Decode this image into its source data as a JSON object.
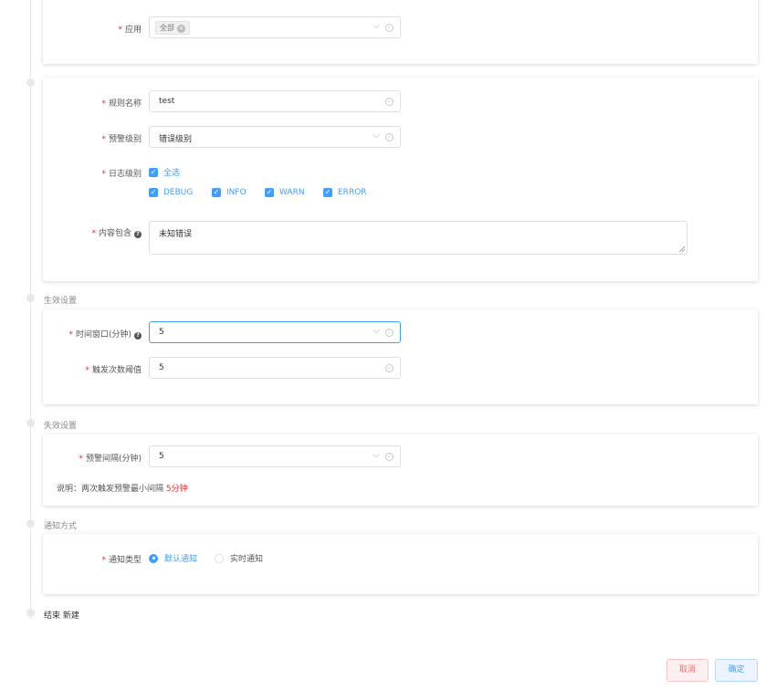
{
  "app_section": {
    "label": "应用",
    "tag": "全部"
  },
  "rule_section": {
    "name_label": "规则名称",
    "name_value": "test",
    "level_label": "预警级别",
    "level_value": "错误级别",
    "log_level_label": "日志级别",
    "log_levels": [
      "全选",
      "DEBUG",
      "INFO",
      "WARN",
      "ERROR"
    ],
    "content_label": "内容包含",
    "content_value": "未知错误"
  },
  "effective_section": {
    "title": "生效设置",
    "window_label": "时间窗口(分钟)",
    "window_value": "5",
    "threshold_label": "触发次数阈值",
    "threshold_value": "5"
  },
  "invalid_section": {
    "title": "失效设置",
    "interval_label": "预警间隔(分钟)",
    "interval_value": "5",
    "note_prefix": "说明：两次触发预警最小间隔 ",
    "note_highlight": "5分钟"
  },
  "notify_section": {
    "title": "通知方式",
    "type_label": "通知类型",
    "options": [
      "默认通知",
      "实时通知"
    ],
    "selected": "默认通知"
  },
  "end_label": "结束 新建",
  "buttons": {
    "cancel": "取消",
    "ok": "确定"
  },
  "colors": {
    "primary": "#409eff",
    "required": "#f5222d",
    "danger": "#f56c6c"
  }
}
